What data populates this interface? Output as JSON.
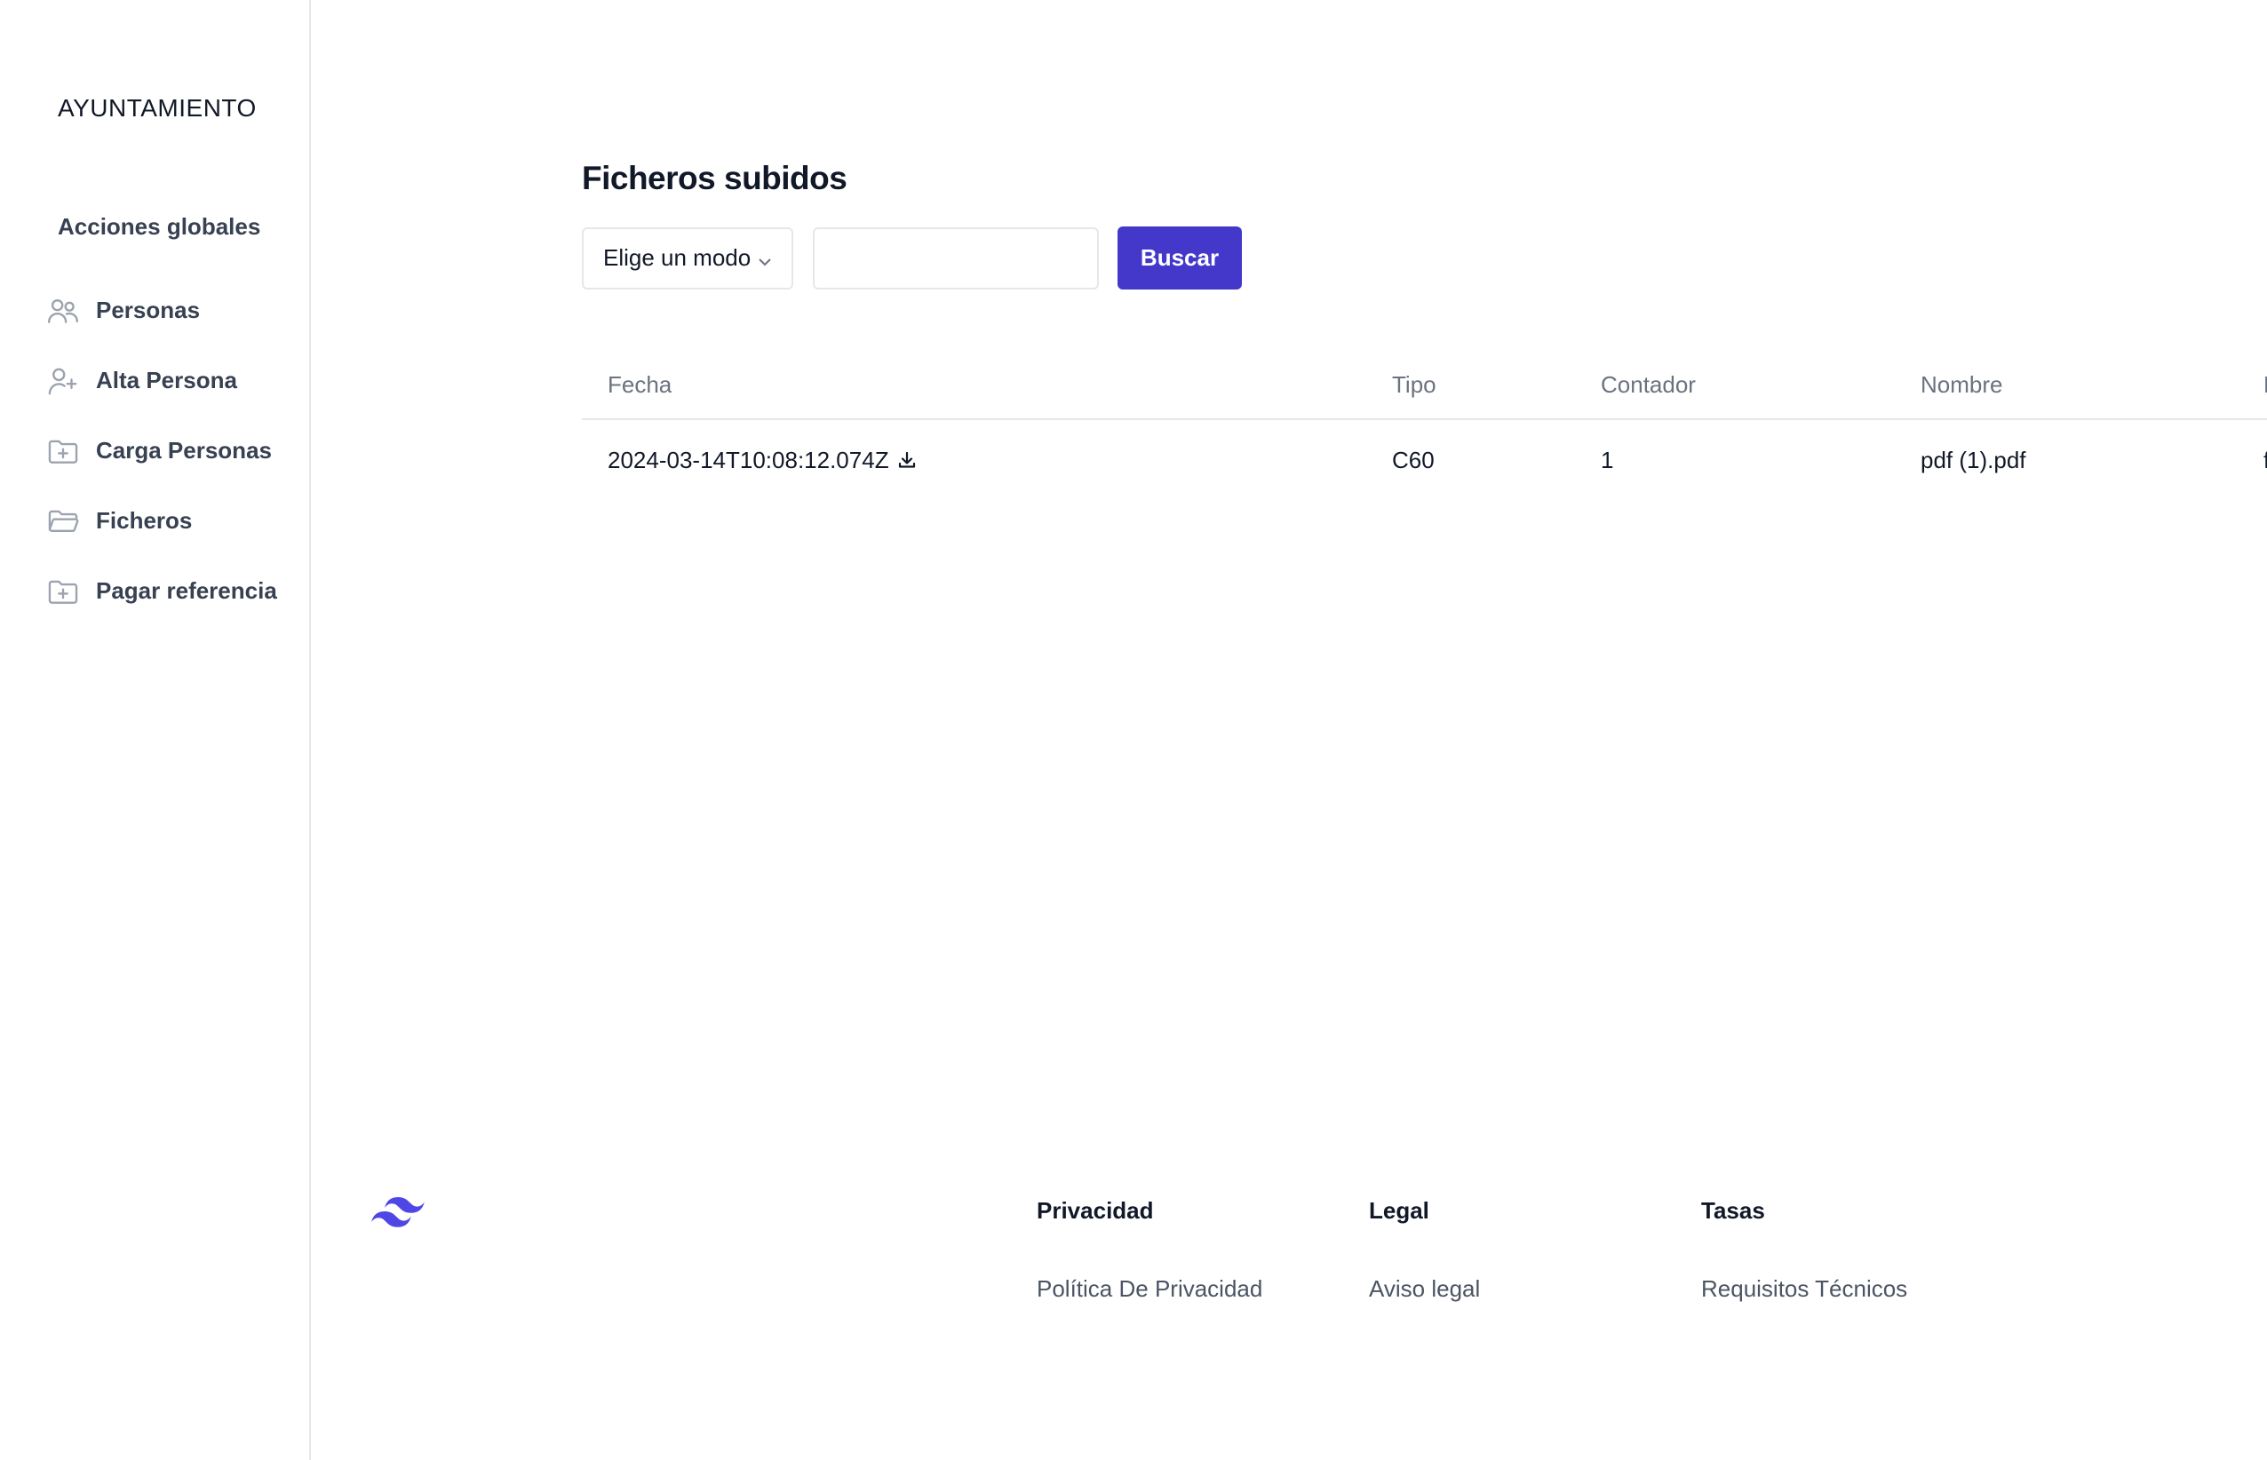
{
  "sidebar": {
    "brand": "AYUNTAMIENTO",
    "section_title": "Acciones globales",
    "items": [
      {
        "label": "Personas",
        "icon": "users-icon"
      },
      {
        "label": "Alta Persona",
        "icon": "user-plus-icon"
      },
      {
        "label": "Carga Personas",
        "icon": "folder-plus-icon"
      },
      {
        "label": "Ficheros",
        "icon": "folder-open-icon"
      },
      {
        "label": "Pagar referencia",
        "icon": "folder-plus-icon"
      }
    ]
  },
  "main": {
    "title": "Ficheros subidos",
    "toolbar": {
      "select_value": "Elige un modo",
      "input_value": "",
      "search_label": "Buscar"
    },
    "table": {
      "columns": [
        "Fecha",
        "Tipo",
        "Contador",
        "Nombre",
        "F"
      ],
      "rows": [
        {
          "fecha": "2024-03-14T10:08:12.074Z",
          "tipo": "C60",
          "contador": "1",
          "nombre": "pdf (1).pdf",
          "extra": "f"
        }
      ]
    }
  },
  "footer": {
    "logo": "tailwind-logo-icon",
    "columns": [
      {
        "heading": "Privacidad",
        "link": "Política De Privacidad"
      },
      {
        "heading": "Legal",
        "link": "Aviso legal"
      },
      {
        "heading": "Tasas",
        "link": "Requisitos Técnicos"
      }
    ]
  },
  "colors": {
    "accent": "#4338ca",
    "logo": "#4f46e5",
    "text_primary": "#111827",
    "text_muted": "#6b7280",
    "border": "#e5e7eb"
  }
}
